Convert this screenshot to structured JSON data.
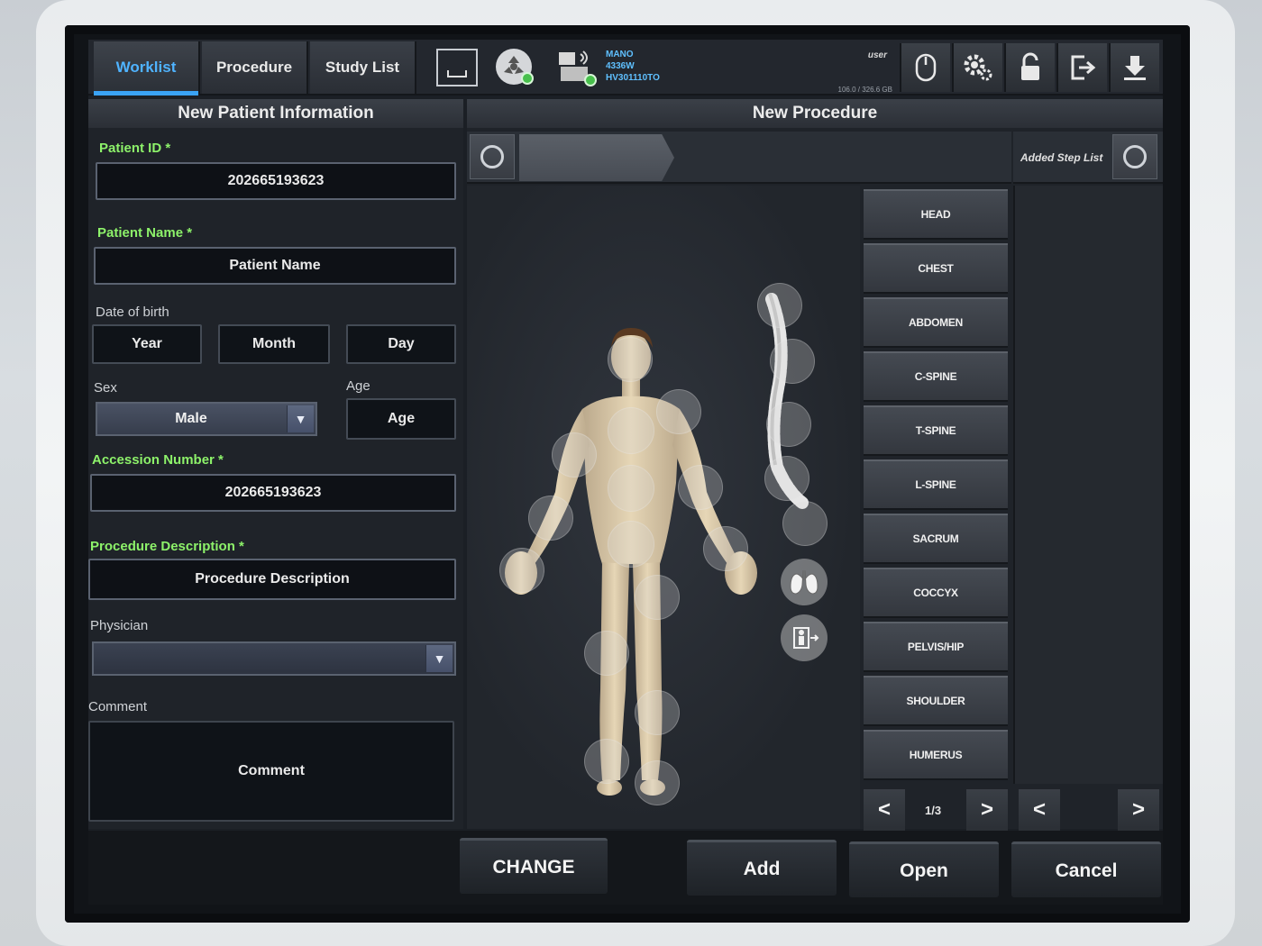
{
  "tabs": [
    {
      "label": "Worklist",
      "active": true
    },
    {
      "label": "Procedure",
      "active": false
    },
    {
      "label": "Study List",
      "active": false
    }
  ],
  "status": {
    "device_lines": [
      "MANO",
      "4336W",
      "HV301110TO"
    ],
    "user": "user",
    "storage": "106.0 / 326.6 GB"
  },
  "toolbar_icons": [
    "mouse-icon",
    "settings-icon",
    "unlock-icon",
    "logout-icon",
    "download-icon"
  ],
  "left_panel": {
    "title": "New Patient Information",
    "patient_id": {
      "label": "Patient ID *",
      "value": "202665193623"
    },
    "patient_name": {
      "label": "Patient Name *",
      "placeholder": "Patient Name"
    },
    "dob": {
      "label": "Date of birth",
      "year": "Year",
      "month": "Month",
      "day": "Day"
    },
    "sex": {
      "label": "Sex",
      "value": "Male"
    },
    "age": {
      "label": "Age",
      "placeholder": "Age"
    },
    "accession": {
      "label": "Accession Number *",
      "value": "202665193623"
    },
    "procedure_desc": {
      "label": "Procedure Description *",
      "placeholder": "Procedure Description"
    },
    "physician": {
      "label": "Physician",
      "value": ""
    },
    "comment": {
      "label": "Comment",
      "placeholder": "Comment"
    }
  },
  "center_panel": {
    "title": "New Procedure",
    "added_step_list": "Added Step List",
    "procedures": [
      "HEAD",
      "CHEST",
      "ABDOMEN",
      "C-SPINE",
      "T-SPINE",
      "L-SPINE",
      "SACRUM",
      "COCCYX",
      "PELVIS/HIP",
      "SHOULDER",
      "HUMERUS"
    ],
    "page": "1/3",
    "prev": "<",
    "next": ">"
  },
  "actions": {
    "change": "CHANGE",
    "add": "Add",
    "open": "Open",
    "cancel": "Cancel"
  },
  "colors": {
    "accent_blue": "#3aa3f5",
    "required_green": "#8df26a",
    "status_green": "#48c04c"
  }
}
